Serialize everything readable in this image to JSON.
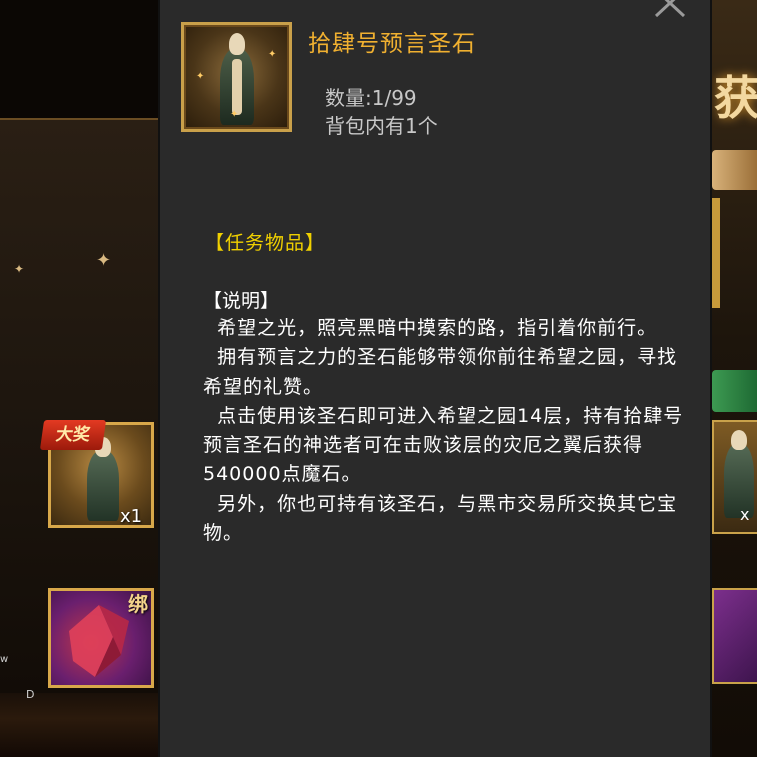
{
  "tooltip": {
    "item_name": "拾肆号预言圣石",
    "quantity": "数量:1/99",
    "bag_count": "背包内有1个",
    "item_type": "【任务物品】",
    "description_header": "【说明】",
    "description": "  希望之光，照亮黑暗中摸索的路，指引着你前行。\n  拥有预言之力的圣石能够带领你前往希望之园，寻找希望的礼赞。\n  点击使用该圣石即可进入希望之园14层，持有拾肆号预言圣石的神选者可在击败该层的灾厄之翼后获得540000点魔石。\n  另外，你也可持有该圣石，与黑市交易所交换其它宝物。",
    "icons": {
      "close": "close-icon",
      "item": "prophecy-stone-statue-icon"
    }
  },
  "background": {
    "left_card1": {
      "badge": "大奖",
      "count": "x1",
      "icon": "statue-icon"
    },
    "left_card2": {
      "badge": "绑",
      "icon": "red-crystal-icon"
    },
    "right_title_glyph": "获",
    "right_card_count": "x",
    "edge_letter_bottom": "D",
    "edge_letter_side": "w"
  },
  "colors": {
    "item_name": "#f0b030",
    "item_type": "#f0d000",
    "panel_bg": "#2a2a2a",
    "frame_gold": "#c9a04a"
  }
}
